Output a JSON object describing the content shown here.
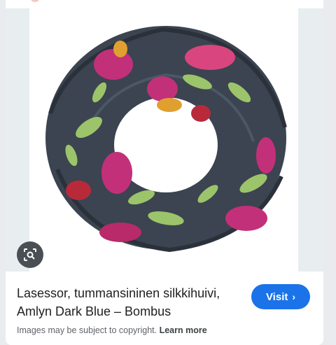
{
  "result": {
    "title": "Lasessor, tummansininen silkkihuivi, Amlyn Dark Blue – Bombus",
    "visit_label": "Visit",
    "visit_icon": "chevron-right-icon",
    "copyright_notice": "Images may be subject to copyright.",
    "learn_more_label": "Learn more",
    "lens_icon": "lens-search-icon"
  },
  "colors": {
    "accent": "#1a73e8",
    "scarf_base": "#3b4450",
    "flower_pink": "#c2307a",
    "flower_red": "#b82a3a",
    "leaf_green": "#9cc46a",
    "flower_yellow": "#e0a030"
  }
}
